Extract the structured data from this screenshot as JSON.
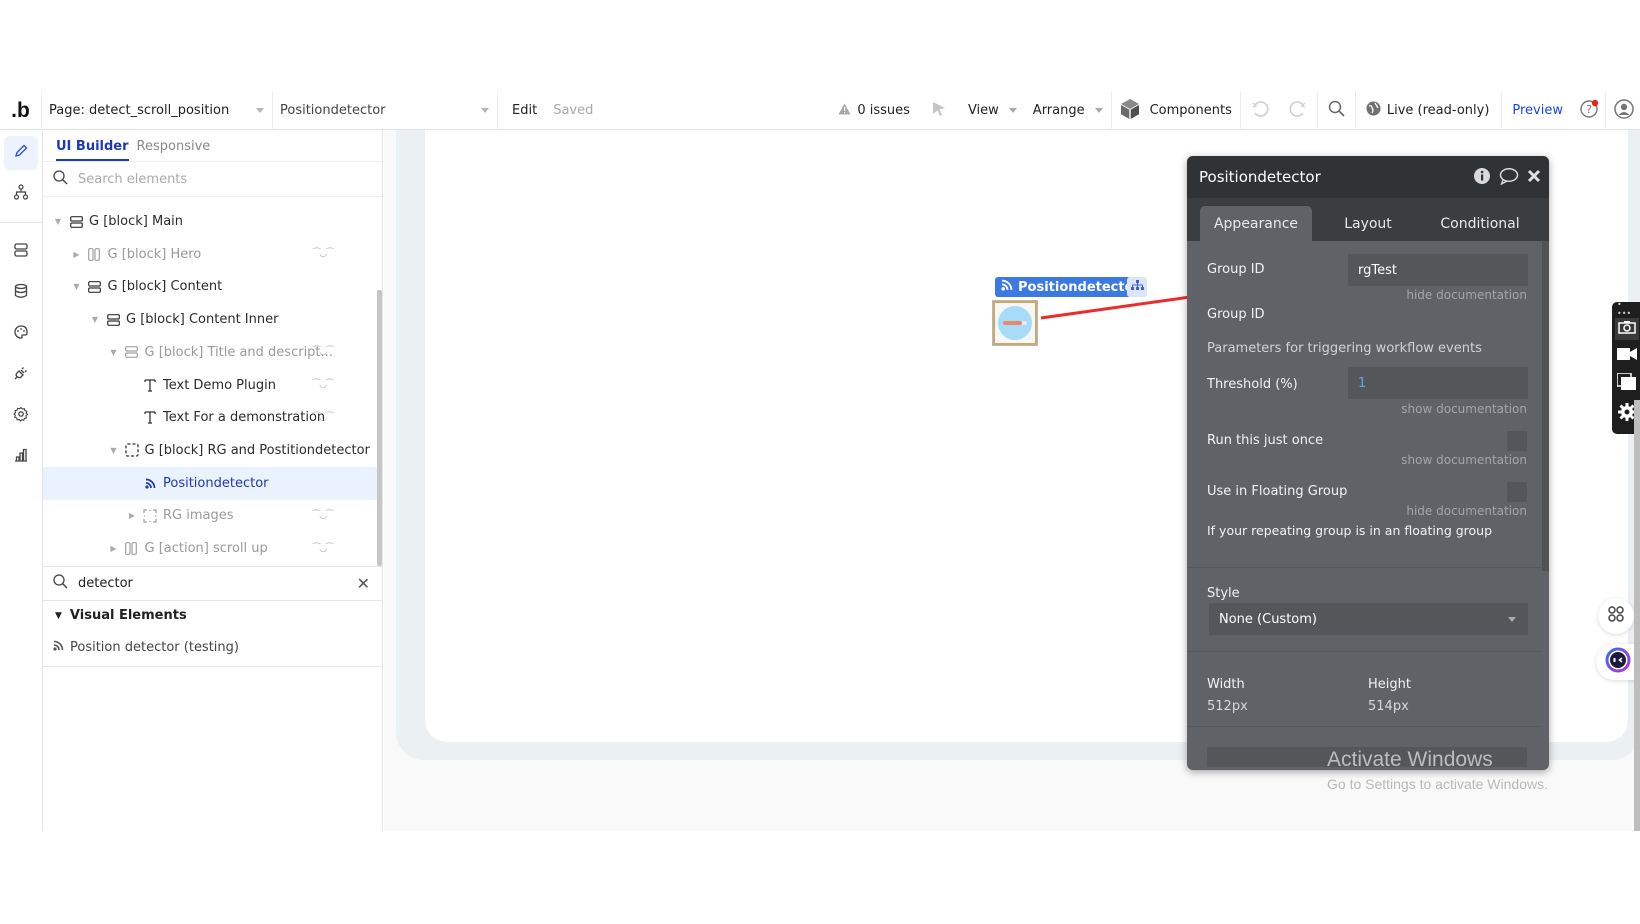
{
  "topbar": {
    "logo": ".b",
    "page_selector": "Page: detect_scroll_position",
    "element_selector": "Positiondetector",
    "edit_label": "Edit",
    "saved_label": "Saved",
    "issues_label": "0 issues",
    "view_label": "View",
    "arrange_label": "Arrange",
    "components_label": "Components",
    "live_label": "Live (read-only)",
    "preview_label": "Preview"
  },
  "rail": {
    "items": [
      "design",
      "workflow",
      "data-types",
      "database",
      "styles",
      "plugins",
      "settings",
      "logs"
    ],
    "active": "design"
  },
  "panel": {
    "tabs": [
      {
        "label": "UI Builder",
        "active": true
      },
      {
        "label": "Responsive",
        "active": false
      }
    ],
    "search_placeholder": "Search elements",
    "tree": [
      {
        "label": "G [block] Main",
        "depth": 0,
        "expanded": true,
        "icon": "group-rows",
        "dim": false,
        "hidden_icon": false
      },
      {
        "label": "G [block] Hero",
        "depth": 1,
        "expanded": false,
        "icon": "group-columns",
        "dim": true,
        "hidden_icon": true
      },
      {
        "label": "G [block] Content",
        "depth": 1,
        "expanded": true,
        "icon": "group-rows",
        "dim": false,
        "hidden_icon": false
      },
      {
        "label": "G [block] Content Inner",
        "depth": 2,
        "expanded": true,
        "icon": "group-rows",
        "dim": false,
        "hidden_icon": false
      },
      {
        "label": "G [block] Title and descript...",
        "depth": 3,
        "expanded": true,
        "icon": "group-rows",
        "dim": true,
        "hidden_icon": true
      },
      {
        "label": "Text Demo Plugin",
        "depth": 4,
        "icon": "text",
        "dim": false,
        "hidden_icon": true
      },
      {
        "label": "Text For a demonstration",
        "depth": 4,
        "icon": "text",
        "dim": false,
        "hidden_icon": true
      },
      {
        "label": "G [block] RG and Postitiondetector",
        "depth": 3,
        "expanded": true,
        "icon": "group-dashed",
        "dim": false,
        "hidden_icon": false
      },
      {
        "label": "Positiondetector",
        "depth": 4,
        "icon": "rss",
        "dim": false,
        "selected": true,
        "hidden_icon": false
      },
      {
        "label": "RG images",
        "depth": 4,
        "expanded": false,
        "icon": "repeating-group",
        "dim": true,
        "hidden_icon": true
      },
      {
        "label": "G [action] scroll up",
        "depth": 3,
        "expanded": false,
        "icon": "group-columns",
        "dim": true,
        "hidden_icon": true
      }
    ],
    "element_search_value": "detector",
    "results_heading": "Visual Elements",
    "results": [
      "Position detector (testing)"
    ]
  },
  "canvas": {
    "element_label": "Positiondetector",
    "element_preview_progress": 0.8
  },
  "property_editor": {
    "title": "Positiondetector",
    "tabs": [
      {
        "label": "Appearance",
        "active": true
      },
      {
        "label": "Layout",
        "active": false
      },
      {
        "label": "Conditional",
        "active": false
      }
    ],
    "group_id_label": "Group ID",
    "group_id_value": "rgTest",
    "group_id_doc_link": "hide documentation",
    "group_id_doc_text": "Group ID",
    "section_heading": "Parameters for triggering workflow events",
    "threshold_label": "Threshold (%)",
    "threshold_value": "1",
    "threshold_doc_link": "show documentation",
    "run_once_label": "Run this just once",
    "run_once_checked": false,
    "run_once_doc_link": "show documentation",
    "floating_label": "Use in Floating Group",
    "floating_checked": false,
    "floating_doc_link": "hide documentation",
    "floating_doc_text": "If your repeating group is in an floating group",
    "style_label": "Style",
    "style_value": "None (Custom)",
    "width_label": "Width",
    "width_value": "512px",
    "height_label": "Height",
    "height_value": "514px"
  },
  "watermark": {
    "line1": "Activate Windows",
    "line2": "Go to Settings to activate Windows."
  }
}
